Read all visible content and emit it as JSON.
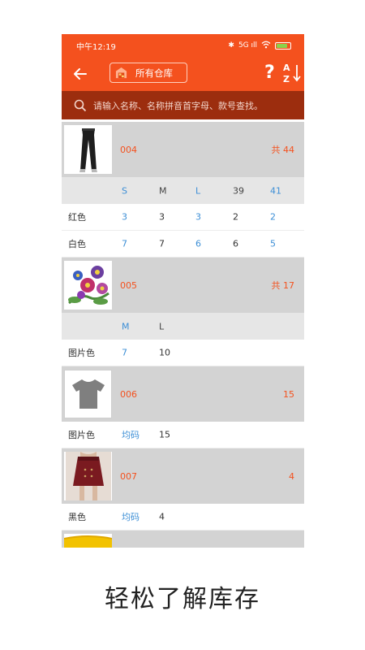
{
  "status_bar": {
    "time": "中午12:19",
    "signal": "5G ıll"
  },
  "toolbar": {
    "warehouse_label": "所有仓库",
    "help_label": "?"
  },
  "search": {
    "placeholder": "请输入名称、名称拼音首字母、款号查找。"
  },
  "products": [
    {
      "code": "004",
      "total": "共 44",
      "thumb_icon": "pants-image",
      "sizes": [
        "S",
        "M",
        "L",
        "39",
        "41"
      ],
      "rows": [
        {
          "color": "红色",
          "qty": [
            "3",
            "3",
            "3",
            "2",
            "2"
          ]
        },
        {
          "color": "白色",
          "qty": [
            "7",
            "7",
            "6",
            "6",
            "5"
          ]
        }
      ]
    },
    {
      "code": "005",
      "total": "共 17",
      "thumb_icon": "flower-image",
      "sizes": [
        "M",
        "L"
      ],
      "rows": [
        {
          "color": "图片色",
          "qty": [
            "7",
            "10"
          ]
        }
      ]
    },
    {
      "code": "006",
      "total": "15",
      "thumb_icon": "tshirt-icon",
      "sizes": [],
      "rows": [
        {
          "color": "图片色",
          "label": "均码",
          "qty": [
            "15"
          ]
        }
      ]
    },
    {
      "code": "007",
      "total": "4",
      "thumb_icon": "skirt-image",
      "sizes": [],
      "rows": [
        {
          "color": "黑色",
          "label": "均码",
          "qty": [
            "4"
          ]
        }
      ]
    }
  ],
  "caption": "轻松了解库存",
  "colors": {
    "accent": "#f4511e",
    "search_bg": "#9c2d0e",
    "size_blue": "#3d8fd6"
  }
}
